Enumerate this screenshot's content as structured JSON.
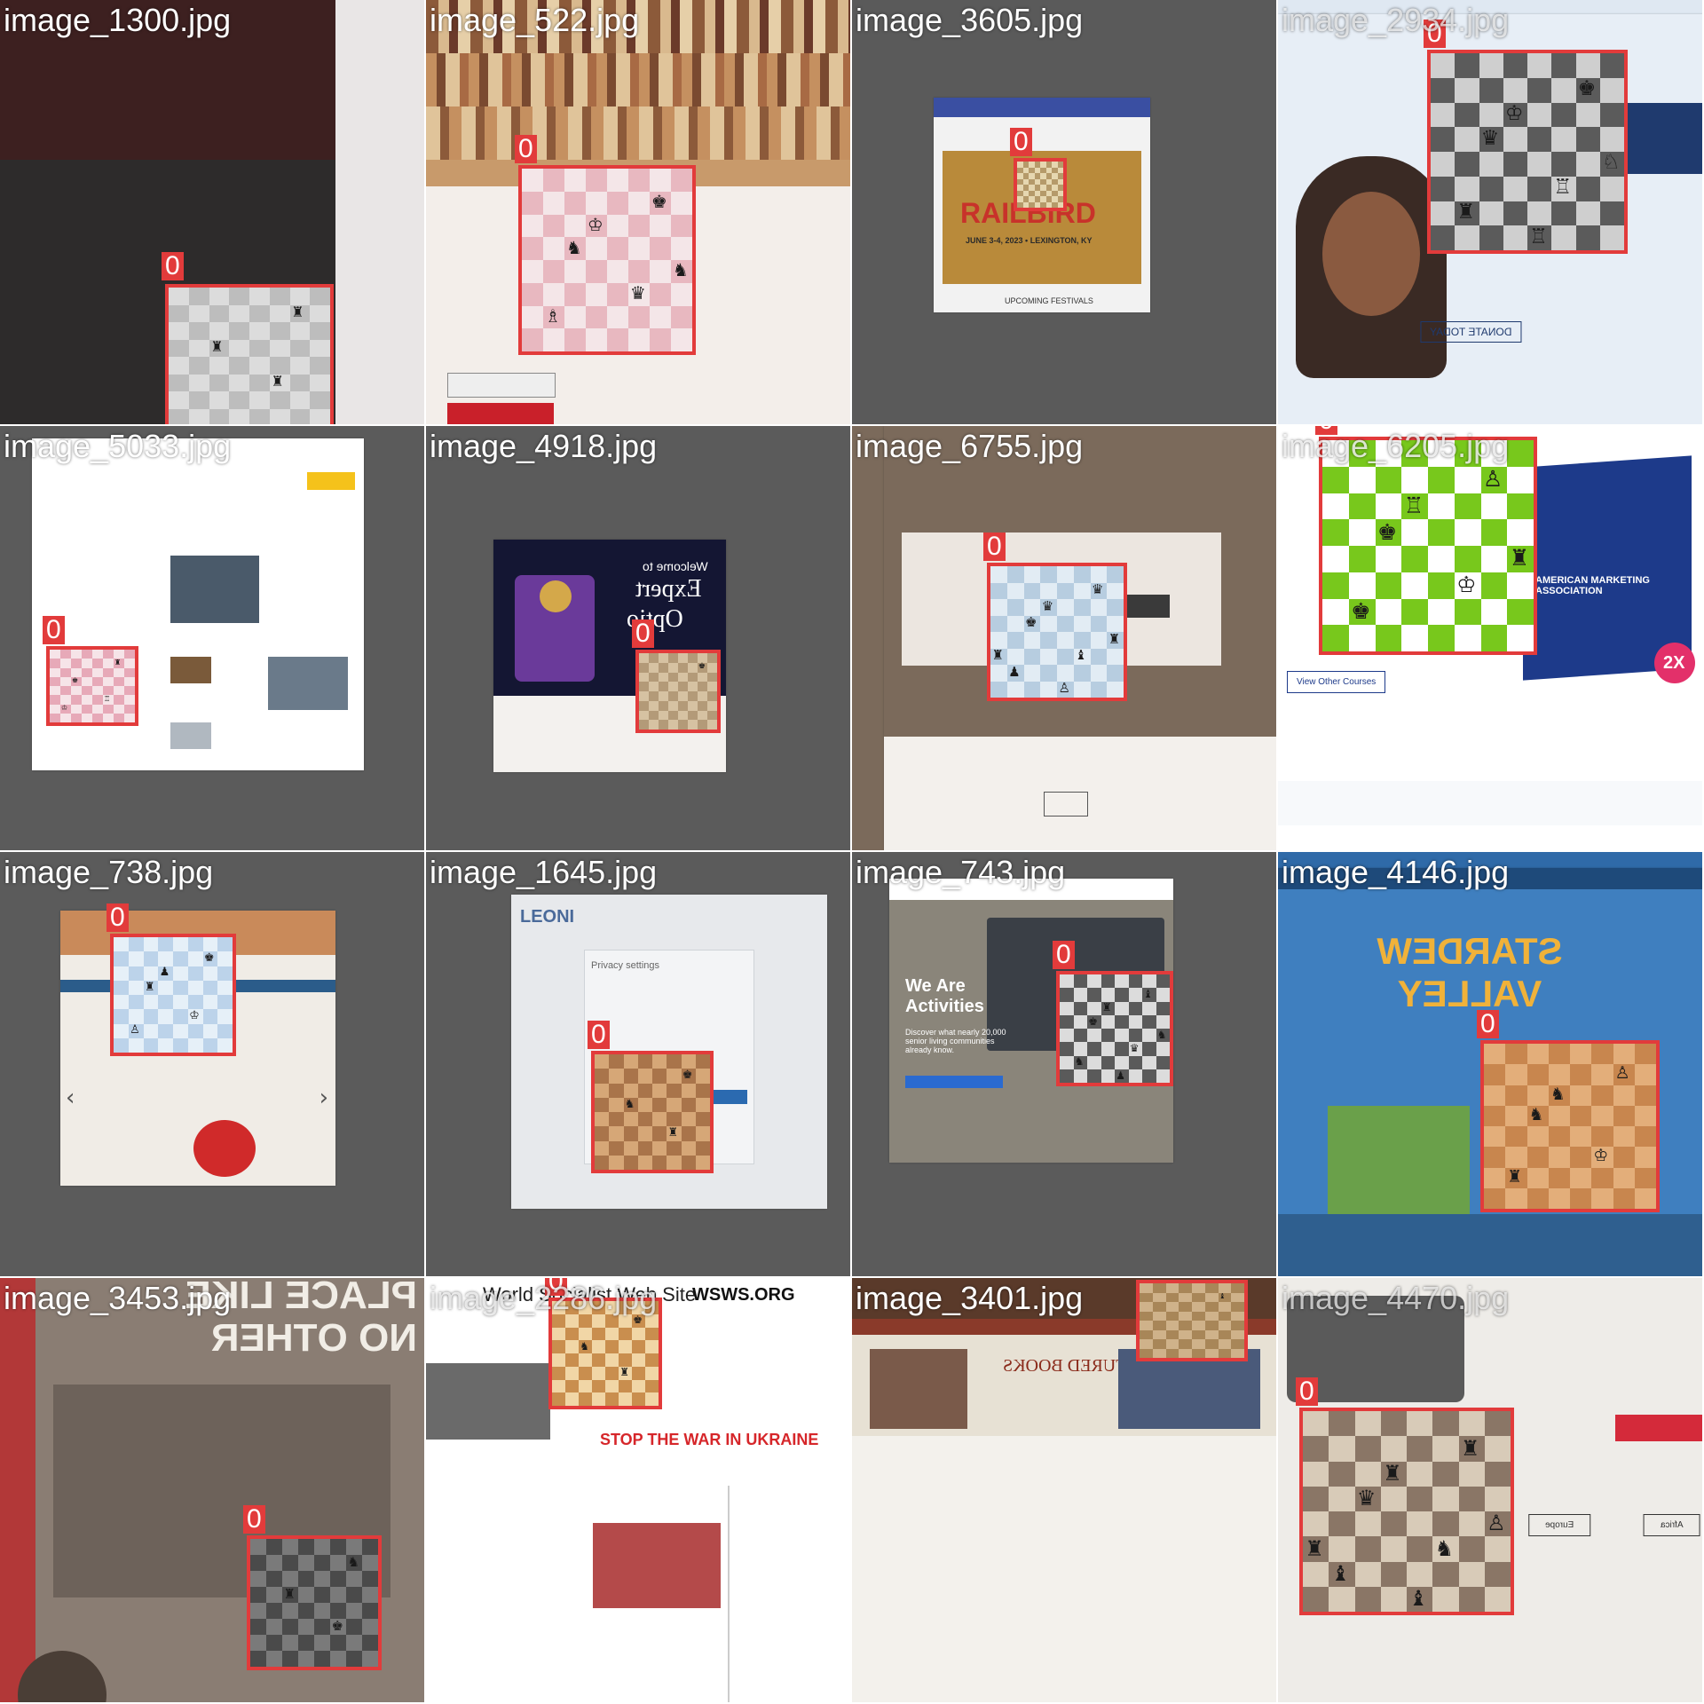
{
  "colors": {
    "box": "#e23b3b",
    "label": "#ffffff"
  },
  "class_id": "0",
  "tiles": [
    {
      "id": 0,
      "filename": "image_1300.jpg",
      "background": "#2b2a2a",
      "page": "#3a3636",
      "board_colors": [
        "#dcdcdc",
        "#bdbdbd"
      ],
      "pieces": [
        "♜",
        "♜",
        "♜"
      ]
    },
    {
      "id": 1,
      "filename": "image_522.jpg",
      "background": "#c89a6b",
      "page": "#f3eeea",
      "board_colors": [
        "#f4e6e8",
        "#e8b8c0"
      ],
      "pieces": [
        "♚",
        "♞",
        "♛",
        "♗",
        "♔",
        "♞"
      ]
    },
    {
      "id": 2,
      "filename": "image_3605.jpg",
      "background": "#5a5a5a",
      "page": "#f2f2f2",
      "board_colors": [
        "#e6d7b0",
        "#b59a6a"
      ],
      "pieces": [],
      "event_title": "RAILBIRD",
      "event_date": "JUNE 3-4, 2023 • LEXINGTON, KY",
      "event_caption": "UPCOMING FESTIVALS"
    },
    {
      "id": 3,
      "filename": "image_2934.jpg",
      "background": "#dfe8f2",
      "page": "#ffffff",
      "board_colors": [
        "#cfcfcf",
        "#5b5b5b"
      ],
      "pieces": [
        "♚",
        "♛",
        "♖",
        "♜",
        "♔",
        "♘",
        "♖"
      ],
      "button_text": "DONATE TODAY"
    },
    {
      "id": 4,
      "filename": "image_5033.jpg",
      "background": "#5b5b5b",
      "page": "#ffffff",
      "board_colors": [
        "#f6e4e8",
        "#e7a9b8"
      ],
      "pieces": [
        "♜",
        "♚",
        "♖",
        "♔"
      ]
    },
    {
      "id": 5,
      "filename": "image_4918.jpg",
      "background": "#5b5b5b",
      "page": "#141633",
      "board_colors": [
        "#d6c2a2",
        "#b39a78"
      ],
      "pieces": [
        "♚"
      ],
      "hero_lines": [
        "Welcome to",
        "Expert",
        "Optio"
      ]
    },
    {
      "id": 6,
      "filename": "image_6755.jpg",
      "background": "#7b6a5b",
      "page": "#e6e1dc",
      "board_colors": [
        "#e2ecf4",
        "#b7cde0"
      ],
      "pieces": [
        "♛",
        "♚",
        "♝",
        "♟",
        "♛",
        "♜",
        "♙",
        "♜"
      ]
    },
    {
      "id": 7,
      "filename": "image_6205.jpg",
      "background": "#f4f6f8",
      "page": "#ffffff",
      "board_colors": [
        "#ffffff",
        "#78c81c"
      ],
      "pieces": [
        "♙",
        "♚",
        "♔",
        "♚",
        "♖",
        "♜"
      ],
      "brand_text": "AMERICAN MARKETING ASSOCIATION",
      "badge_text": "2X",
      "button_text": "View Other Courses"
    },
    {
      "id": 8,
      "filename": "image_738.jpg",
      "background": "#5b5b5b",
      "page": "#f0ece6",
      "board_colors": [
        "#e6f0f8",
        "#bcd3ea"
      ],
      "pieces": [
        "♚",
        "♜",
        "♔",
        "♙",
        "♟"
      ]
    },
    {
      "id": 9,
      "filename": "image_1645.jpg",
      "background": "#5b5b5b",
      "page": "#e7e9ec",
      "board_colors": [
        "#d6a777",
        "#a9744a"
      ],
      "pieces": [
        "♚",
        "♞",
        "♜"
      ],
      "brand_text": "LEONI",
      "dialog_title": "Privacy settings"
    },
    {
      "id": 10,
      "filename": "image_743.jpg",
      "background": "#5b5b5b",
      "page": "#8a857a",
      "board_colors": [
        "#dcdcdc",
        "#5a5a5a"
      ],
      "pieces": [
        "♝",
        "♚",
        "♛",
        "♞",
        "♜",
        "♞",
        "♟"
      ],
      "headline": "We Are Activities",
      "subline": "Discover what nearly 20,000 senior living communities already know."
    },
    {
      "id": 11,
      "filename": "image_4146.jpg",
      "background": "#2f6aa8",
      "page": "#2f6aa8",
      "board_colors": [
        "#e3ae7a",
        "#c8864e"
      ],
      "pieces": [
        "♙",
        "♞",
        "♔",
        "♜",
        "♞"
      ],
      "game_title": "STARDEW VALLEY"
    },
    {
      "id": 12,
      "filename": "image_3453.jpg",
      "background": "#8a7d73",
      "page": "#8a7d73",
      "board_colors": [
        "#7a7a7a",
        "#4a4a4a"
      ],
      "pieces": [
        "♞",
        "♜",
        "♚"
      ],
      "banner_text": "PLACE LIKE NO OTHER"
    },
    {
      "id": 13,
      "filename": "image_2286.jpg",
      "background": "#ffffff",
      "page": "#ffffff",
      "board_colors": [
        "#f1d6a6",
        "#c98e4e"
      ],
      "pieces": [
        "♚",
        "♞",
        "♜"
      ],
      "site_title": "World Socialist Web Site",
      "site_logo": "WSWS.ORG",
      "headline": "STOP THE WAR IN UKRAINE"
    },
    {
      "id": 14,
      "filename": "image_3401.jpg",
      "background": "#dad7cf",
      "page": "#f3f1ec",
      "board_colors": [
        "#cfb28a",
        "#a88658"
      ],
      "pieces": [
        "♝"
      ],
      "banner_text": "FEATURED BOOKS"
    },
    {
      "id": 15,
      "filename": "image_4470.jpg",
      "background": "#eeece8",
      "page": "#eeece8",
      "board_colors": [
        "#d8cbb8",
        "#8a7666"
      ],
      "pieces": [
        "♜",
        "♛",
        "♞",
        "♝",
        "♜",
        "♙",
        "♝",
        "♜"
      ],
      "buttons": [
        "Africa",
        "Europe"
      ]
    }
  ]
}
